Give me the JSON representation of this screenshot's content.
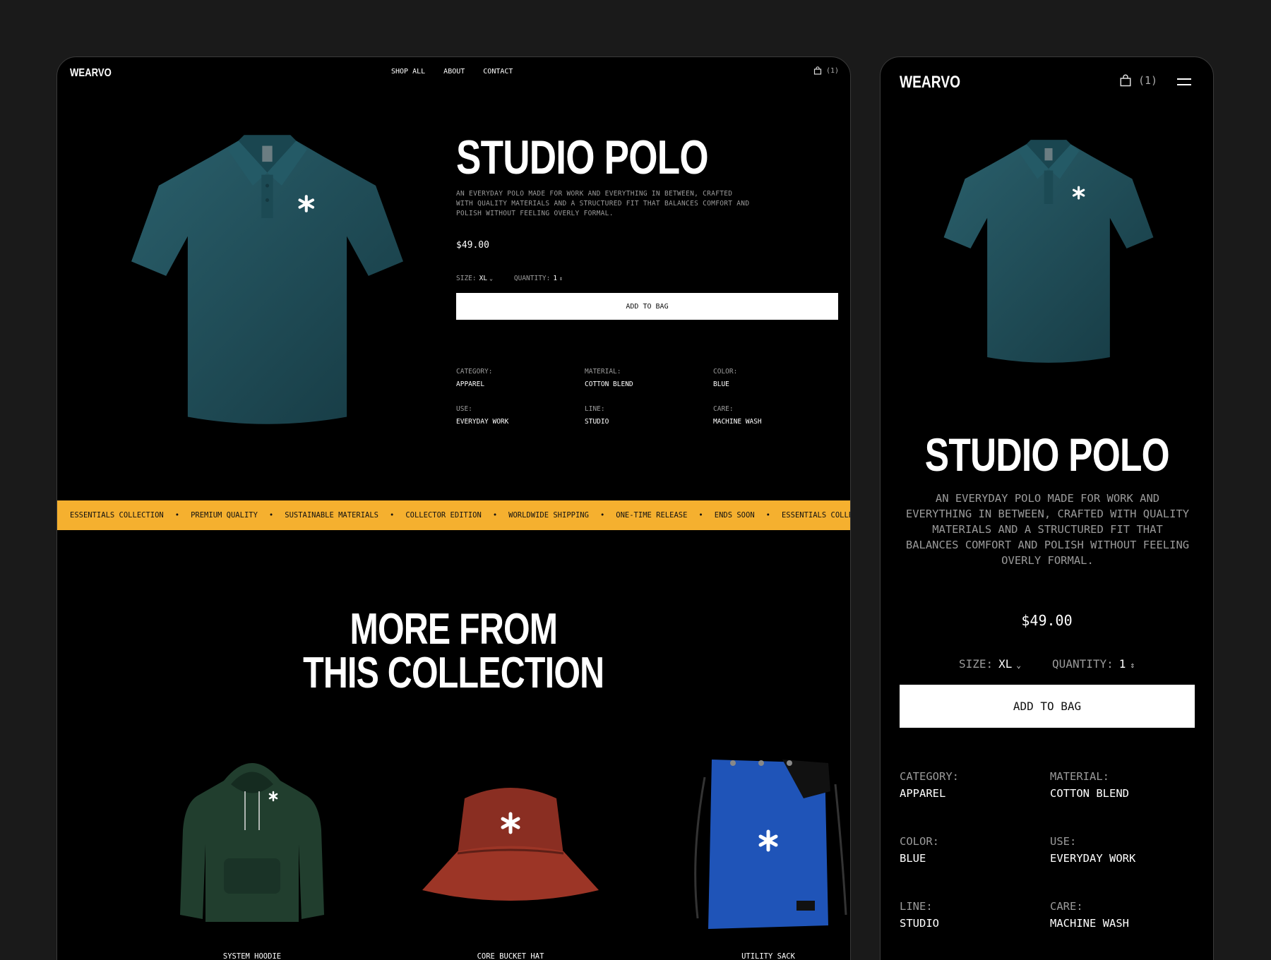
{
  "brand": "WEARVO",
  "nav": {
    "links": [
      "SHOP ALL",
      "ABOUT",
      "CONTACT"
    ],
    "cart_count": "(1)",
    "cart_icon": "shopping-bag-icon",
    "menu_icon": "hamburger-menu-icon"
  },
  "product": {
    "title": "STUDIO POLO",
    "description": "AN EVERYDAY POLO MADE FOR WORK AND EVERYTHING IN BETWEEN, CRAFTED WITH QUALITY MATERIALS AND A STRUCTURED FIT THAT BALANCES COMFORT AND POLISH WITHOUT FEELING OVERLY FORMAL.",
    "price": "$49.00",
    "size_label": "SIZE:",
    "size_value": "XL",
    "quantity_label": "QUANTITY:",
    "quantity_value": "1",
    "add_to_bag": "ADD TO BAG",
    "color": "#1f4f5a",
    "specs": {
      "category": {
        "label": "CATEGORY:",
        "value": "APPAREL"
      },
      "material": {
        "label": "MATERIAL:",
        "value": "COTTON BLEND"
      },
      "color": {
        "label": "COLOR:",
        "value": "BLUE"
      },
      "use": {
        "label": "USE:",
        "value": "EVERYDAY WORK"
      },
      "line": {
        "label": "LINE:",
        "value": "STUDIO"
      },
      "care": {
        "label": "CARE:",
        "value": "MACHINE WASH"
      }
    }
  },
  "marquee": {
    "items": [
      "ESSENTIALS COLLECTION",
      "PREMIUM QUALITY",
      "SUSTAINABLE MATERIALS",
      "COLLECTOR EDITION",
      "WORLDWIDE SHIPPING",
      "ONE-TIME RELEASE",
      "ENDS SOON",
      "ESSENTIALS COLLECTION"
    ],
    "separator": "•",
    "background": "#f5b02f"
  },
  "collection": {
    "title_line1": "MORE FROM",
    "title_line2": "THIS COLLECTION",
    "products": [
      {
        "name": "SYSTEM HOODIE",
        "color": "#1f3a2c"
      },
      {
        "name": "CORE BUCKET HAT",
        "color": "#8a2e22"
      },
      {
        "name": "UTILITY SACK",
        "color": "#1f54b8"
      }
    ]
  },
  "colors": {
    "page_bg": "#1a1a1a",
    "frame_bg": "#000000",
    "muted_text": "#9a9a9a"
  }
}
